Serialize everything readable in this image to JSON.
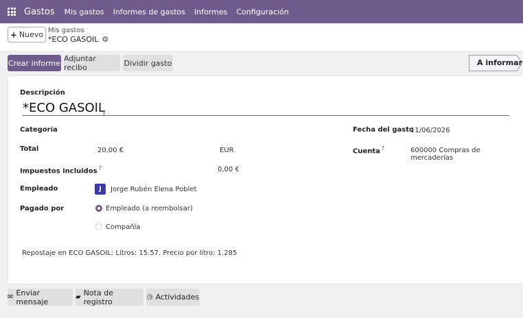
{
  "navbar": {
    "app_name": "Gastos",
    "menu": [
      "Mis gastos",
      "Informes de gastos",
      "Informes",
      "Configuración"
    ]
  },
  "control": {
    "new_label": "Nuevo",
    "breadcrumb": "Mis gastos",
    "record_title": "*ECO GASOIL"
  },
  "actions": {
    "create_report": "Crear informe",
    "attach_receipt": "Adjuntar recibo",
    "split_expense": "Dividir gasto",
    "status": "A informar"
  },
  "form": {
    "description_label": "Descripción",
    "description_value": "*ECO GASOIL",
    "category_label": "Categoría",
    "total_label": "Total",
    "total_value": "20,00 €",
    "currency": "EUR",
    "taxes_label": "Impuestos incluidos",
    "taxes_value": "0,00 €",
    "employee_label": "Empleado",
    "employee_avatar": "J",
    "employee_name": "Jorge Rubén Elena Poblet",
    "paid_by_label": "Pagado por",
    "paid_by_options": [
      "Empleado (a reembolsar)",
      "Compañía"
    ],
    "paid_by_selected": "Empleado (a reembolsar)",
    "date_label": "Fecha del gasto",
    "date_value": "11/06/2026",
    "account_label": "Cuenta",
    "account_value": "600000 Compras de mercaderías",
    "help_mark": "?",
    "notes": "Repostaje en ECO GASOIL: Litros: 15.57. Precio por litro: 1.285"
  },
  "chatter": {
    "send_message": "Enviar mensaje",
    "log_note": "Nota de registro",
    "activities": "Actividades"
  },
  "colors": {
    "primary": "#6f5c8c",
    "avatar": "#3d3aa8"
  }
}
